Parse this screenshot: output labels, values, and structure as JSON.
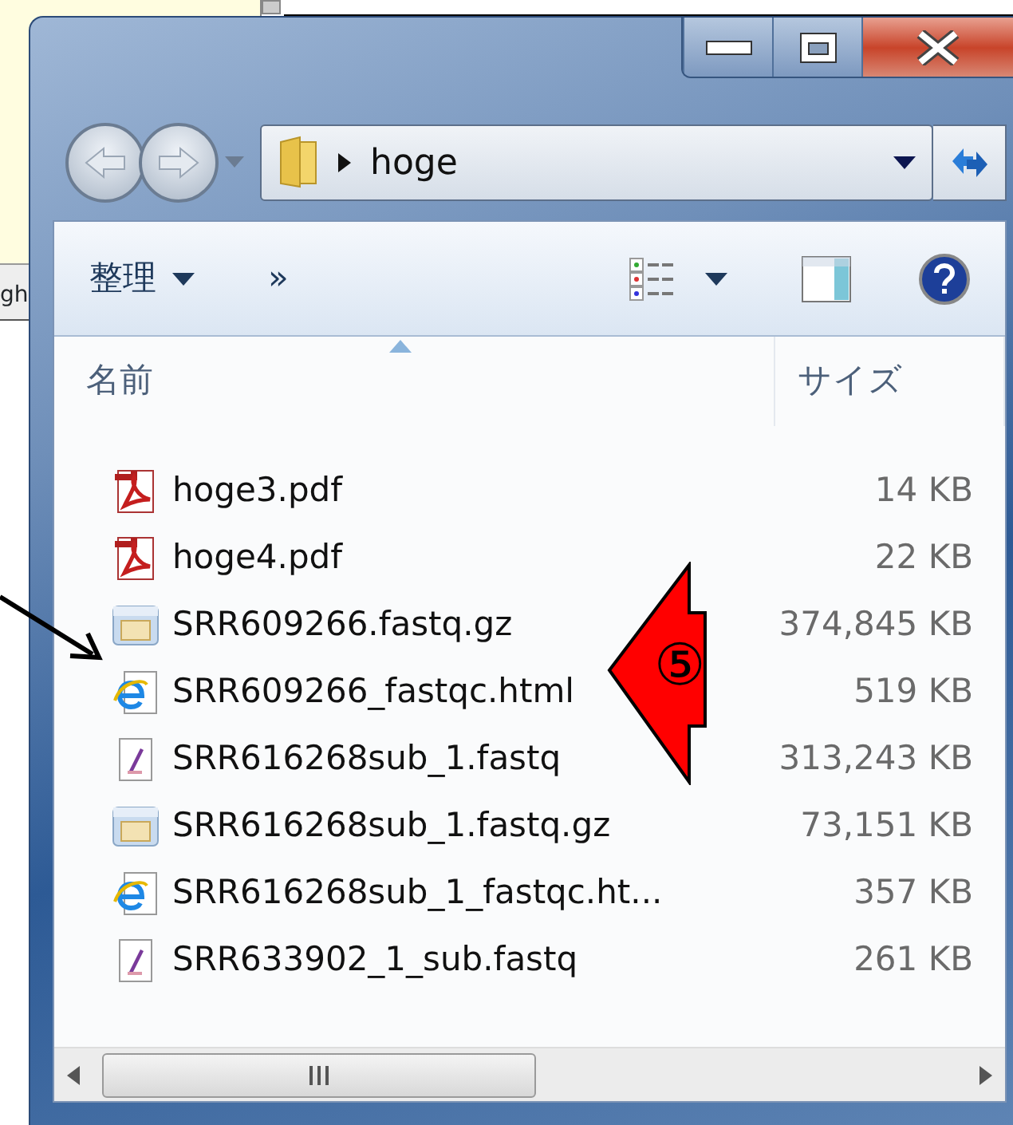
{
  "background_window": {
    "tab_fragment": "gh"
  },
  "address_bar": {
    "path": [
      "hoge"
    ]
  },
  "toolbar": {
    "organize": "整理",
    "more": "»"
  },
  "columns": [
    {
      "label": "名前",
      "sorted": true
    },
    {
      "label": "サイズ",
      "sorted": false
    }
  ],
  "files": [
    {
      "name": "hoge3.pdf",
      "size": "14 KB",
      "kind": "pdf"
    },
    {
      "name": "hoge4.pdf",
      "size": "22 KB",
      "kind": "pdf"
    },
    {
      "name": "SRR609266.fastq.gz",
      "size": "374,845 KB",
      "kind": "archive"
    },
    {
      "name": "SRR609266_fastqc.html",
      "size": "519 KB",
      "kind": "html"
    },
    {
      "name": "SRR616268sub_1.fastq",
      "size": "313,243 KB",
      "kind": "text"
    },
    {
      "name": "SRR616268sub_1.fastq.gz",
      "size": "73,151 KB",
      "kind": "archive"
    },
    {
      "name": "SRR616268sub_1_fastqc.ht...",
      "size": "357 KB",
      "kind": "html"
    },
    {
      "name": "SRR633902_1_sub.fastq",
      "size": "261 KB",
      "kind": "text"
    }
  ],
  "annotation": {
    "label": "⑤"
  }
}
